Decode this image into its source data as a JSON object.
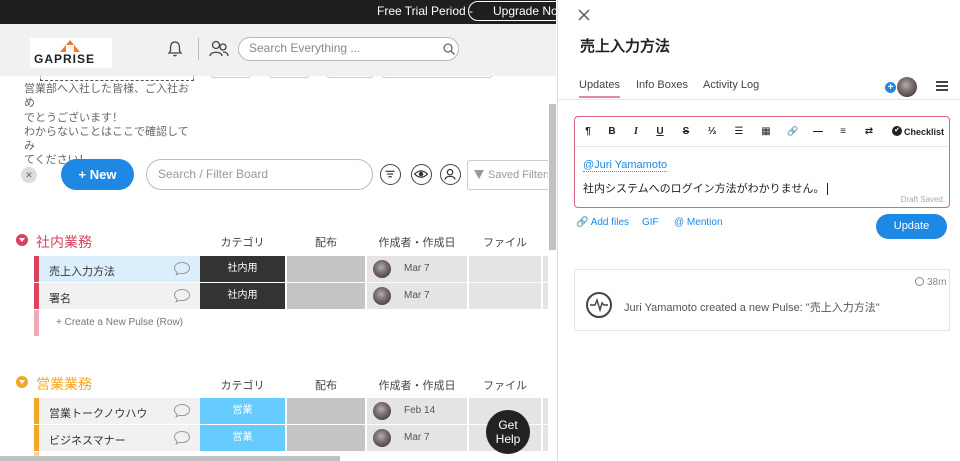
{
  "banner": {
    "trial_text": "Free Trial Period -",
    "upgrade_label": "Upgrade Now"
  },
  "header": {
    "logo_text": "GAPRISE",
    "search_placeholder": "Search Everything ..."
  },
  "board": {
    "description_lines": [
      "営業部へ入社した皆様、ご入社おめ",
      "でとうございます！",
      "わからないことはここで確認してみ",
      "てください！"
    ],
    "new_button_label": "+ New",
    "filter_placeholder": "Search / Filter Board",
    "saved_filters_label": "Saved Filters",
    "columns": {
      "category": "カテゴリ",
      "distribution": "配布",
      "creator": "作成者・作成日",
      "file": "ファイル"
    },
    "create_row_label": "+ Create a New Pulse (Row)",
    "groups": [
      {
        "title": "社内業務",
        "color": "#d9435e",
        "rows": [
          {
            "name": "売上入力方法",
            "category": "社内用",
            "category_color": "#333333",
            "date": "Mar 7",
            "selected": true
          },
          {
            "name": "署名",
            "category": "社内用",
            "category_color": "#333333",
            "date": "Mar 7",
            "selected": false
          }
        ]
      },
      {
        "title": "営業業務",
        "color": "#f5a623",
        "rows": [
          {
            "name": "営業トークノウハウ",
            "category": "営業",
            "category_color": "#66ccff",
            "date": "Feb 14",
            "selected": false
          },
          {
            "name": "ビジネスマナー",
            "category": "営業",
            "category_color": "#66ccff",
            "date": "Mar 7",
            "selected": false
          }
        ]
      }
    ]
  },
  "help_button": {
    "line1": "Get",
    "line2": "Help"
  },
  "panel": {
    "title": "売上入力方法",
    "tabs": [
      "Updates",
      "Info Boxes",
      "Activity Log"
    ],
    "active_tab": "Updates",
    "add_subscriber_glyph": "+",
    "toolbar": {
      "paragraph": "¶",
      "bold": "B",
      "italic": "I",
      "underline": "U",
      "strike": "S",
      "ordered_list": "⅓",
      "bullet_list": "☰",
      "table": "▦",
      "link": "🔗",
      "divider": "—",
      "align": "≡",
      "direction": "⇄",
      "checklist": "Checklist"
    },
    "editor": {
      "mention": "@Juri Yamamoto",
      "text": "社内システムへのログイン方法がわかりません。",
      "draft_status": "Draft Saved"
    },
    "attach": {
      "add_files": "Add files",
      "gif": "GIF",
      "mention": "@ Mention"
    },
    "update_button": "Update",
    "activity": {
      "time": "38m",
      "text": "Juri Yamamoto created a new Pulse: \"売上入力方法\""
    }
  }
}
